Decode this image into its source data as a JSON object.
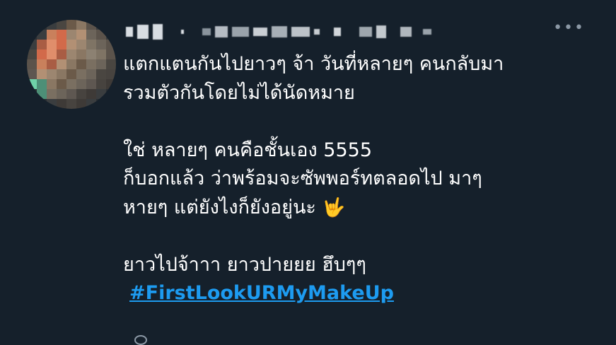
{
  "tweet": {
    "more_icon": "•••",
    "lines": [
      "แตกแตนกันไปยาวๆ จ้า วันที่หลายๆ คนกลับมา",
      "รวมตัวกันโดยไม่ได้นัดหมาย",
      "",
      "ใช่ หลายๆ คนคือชั้นเอง 5555",
      "ก็บอกแล้ว ว่าพร้อมจะซัพพอร์ทตลอดไป มาๆ",
      "หายๆ แต่ยังไงก็ยังอยู่นะ",
      "",
      "ยาวไปจ้าาา ยาวปายยย ฮึบๆๆ"
    ],
    "emoji": "🤟",
    "hashtag": "#FirstLookURMyMakeUp"
  },
  "colors": {
    "background": "#15202b",
    "text": "#ffffff",
    "link": "#1d9bf0",
    "muted": "#8b98a5"
  },
  "icons": {
    "more": "more-options-icon",
    "hand": "love-you-gesture-icon"
  }
}
